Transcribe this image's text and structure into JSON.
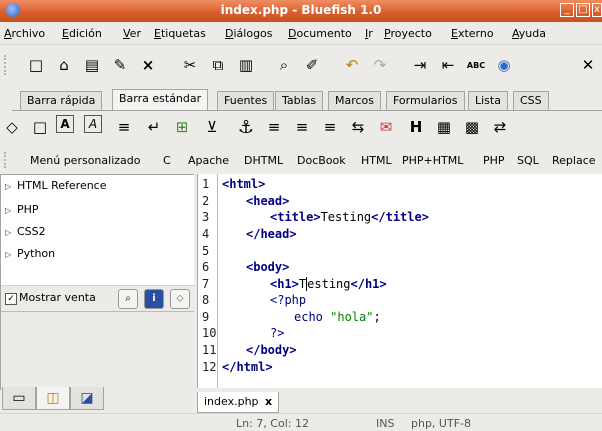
{
  "window": {
    "title": "index.php - Bluefish 1.0",
    "min": "_",
    "max": "□",
    "close": "x"
  },
  "menubar": {
    "items": [
      "Archivo",
      "Edición",
      "Ver",
      "Etiquetas",
      "Diálogos",
      "Documento",
      "Ir",
      "Proyecto",
      "Externo",
      "Ayuda"
    ]
  },
  "toolbar": {
    "new": "□",
    "open": "⌂",
    "save": "▤",
    "save_as": "✎",
    "close": "×",
    "cut": "✂",
    "copy": "⧉",
    "paste": "▥",
    "find": "⌕",
    "replace": "✐",
    "undo": "↶",
    "redo": "↷",
    "indent": "⇥",
    "unindent": "⇤",
    "spell": "ABC",
    "preview": "◉",
    "tools": "✕"
  },
  "htmlbar": {
    "tabs": [
      "Barra rápida",
      "Barra estándar",
      "Fuentes",
      "Tablas",
      "Marcos",
      "Formularios",
      "Lista",
      "CSS"
    ],
    "active_tab": "Barra estándar",
    "buttons": {
      "body": "◇",
      "para": "□",
      "bold": "A",
      "italic": "A",
      "heading": "≡",
      "br": "↵",
      "nbsp": "⊞",
      "underline": "⊻",
      "anchor": "⚓",
      "left": "≡",
      "center": "≡",
      "right": "≡",
      "comment": "⇆",
      "email": "✉",
      "h": "H",
      "image": "▦",
      "thumb": "▩",
      "link": "⇄"
    }
  },
  "custom_menu": {
    "items": [
      "Menú personalizado",
      "C",
      "Apache",
      "DHTML",
      "DocBook",
      "HTML",
      "PHP+HTML",
      "PHP",
      "SQL",
      "Replace"
    ]
  },
  "sidebar": {
    "tree": [
      {
        "label": "HTML Reference"
      },
      {
        "label": "PHP"
      },
      {
        "label": "CSS2"
      },
      {
        "label": "Python"
      }
    ],
    "show_label": "Mostrar venta",
    "show_checked": "✓",
    "search_icon": "⌕",
    "info_icon": "i",
    "insert_icon": "⬦",
    "tabs": [
      "filebrowser",
      "functions",
      "bookmarks"
    ]
  },
  "editor": {
    "lines": [
      {
        "n": "1"
      },
      {
        "n": "2"
      },
      {
        "n": "3"
      },
      {
        "n": "4"
      },
      {
        "n": "5"
      },
      {
        "n": "6"
      },
      {
        "n": "7"
      },
      {
        "n": "8"
      },
      {
        "n": "9"
      },
      {
        "n": "10"
      },
      {
        "n": "11"
      },
      {
        "n": "12"
      }
    ],
    "code": {
      "l1_open": "<html>",
      "l2_open": "<head>",
      "l3_title_open": "<title>",
      "l3_text": "Testing",
      "l3_title_close": "</title>",
      "l4_close": "</head>",
      "l6_open": "<body>",
      "l7_h1_open": "<h1>",
      "l7_text_a": "T",
      "l7_text_b": "esting",
      "l7_h1_close": "</h1>",
      "l8_php": "<?php",
      "l9_echo": "echo ",
      "l9_str": "\"hola\"",
      "l9_end": ";",
      "l10_close": "?>",
      "l11_close": "</body>",
      "l12_close": "</html>"
    },
    "tab_label": "index.php",
    "tab_close": "x"
  },
  "status": {
    "position": "Ln: 7, Col: 12",
    "mode": "INS",
    "encoding": "php, UTF-8"
  },
  "colors": {
    "titlebar": "#d9602e",
    "tag": "#000080",
    "string": "#008000"
  }
}
